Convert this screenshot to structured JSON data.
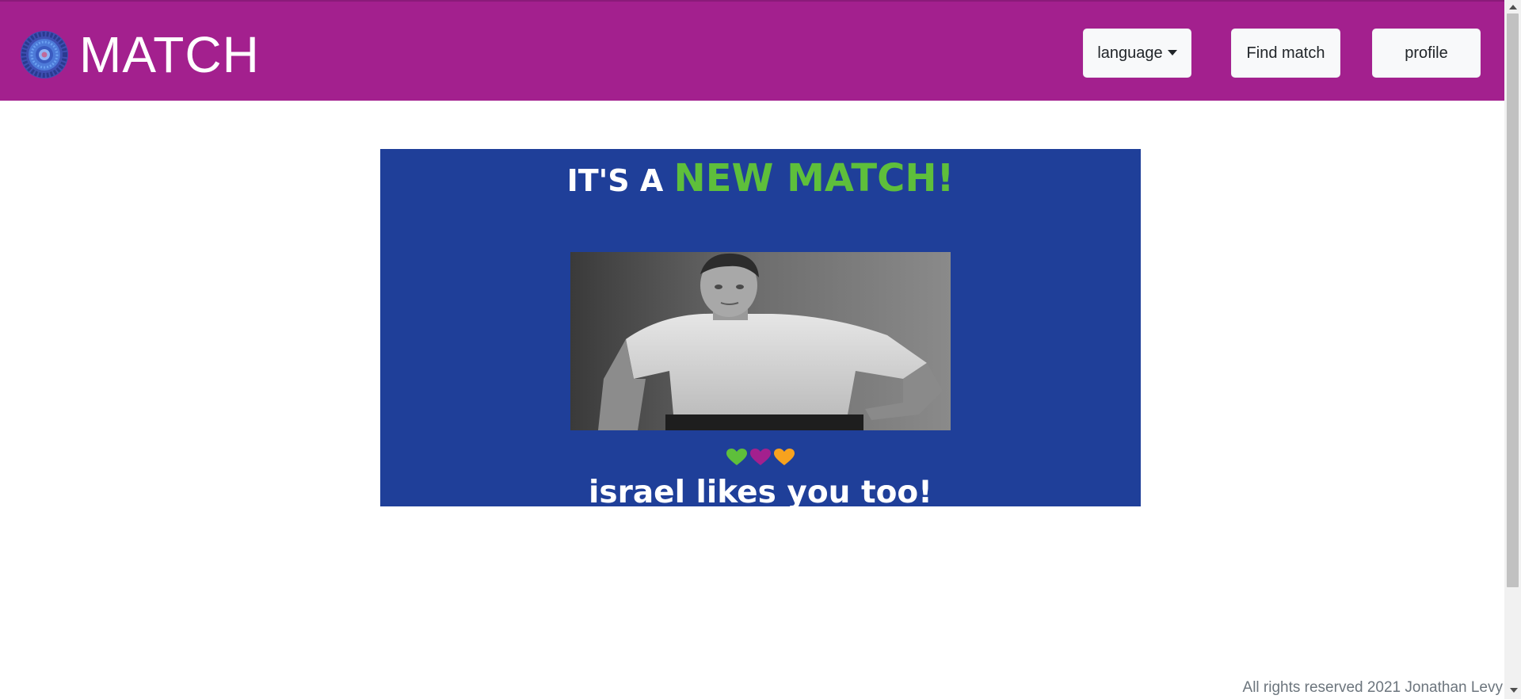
{
  "app": {
    "brand": "MATCH",
    "logo_icon": "mandala-logo-icon"
  },
  "nav": {
    "language_label": "language",
    "language_icon": "caret-down-icon",
    "find_match_label": "Find match",
    "profile_label": "profile"
  },
  "card": {
    "headline_prefix": "IT'S A",
    "headline_accent": "NEW MATCH!",
    "photo_alt": "israel",
    "hearts": [
      "heart-icon-green",
      "heart-icon-purple",
      "heart-icon-orange"
    ],
    "message": "israel likes you too!"
  },
  "footer": {
    "text": "All rights reserved 2021 Jonathan Levy"
  },
  "colors": {
    "navbar": "#a3208e",
    "card_background": "#1f3f99",
    "accent_green": "#5ebf3b",
    "heart_green": "#5ebf3b",
    "heart_purple": "#a3208e",
    "heart_orange": "#f7a21e"
  }
}
